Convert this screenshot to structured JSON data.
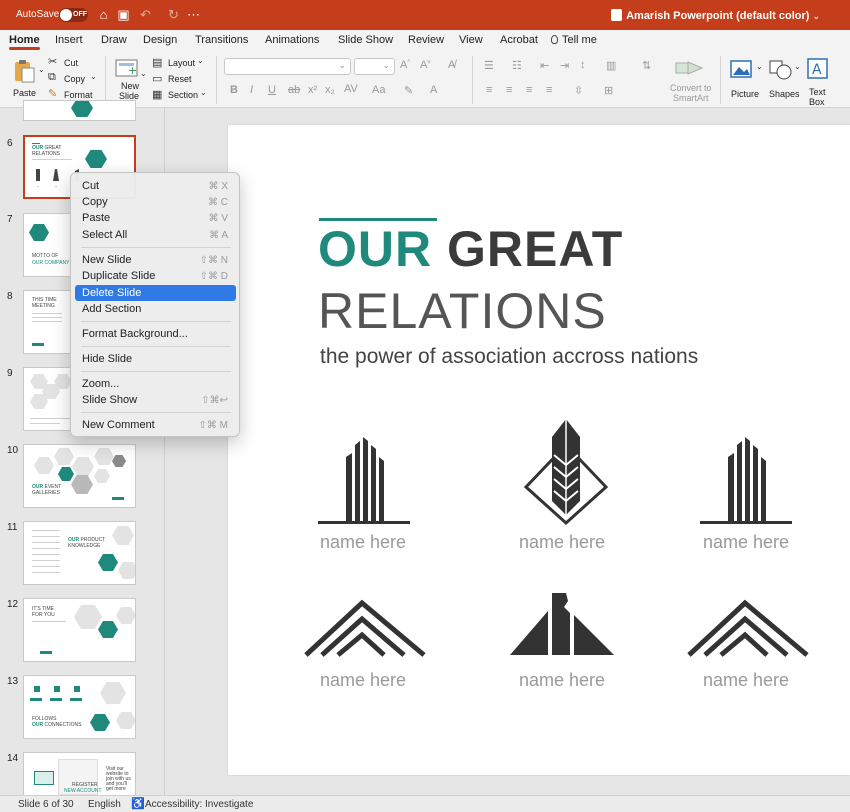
{
  "titlebar": {
    "autosave_label": "AutoSave",
    "autosave_state": "OFF",
    "document_title": "Amarish Powerpoint (default color)"
  },
  "tabs": [
    "Home",
    "Insert",
    "Draw",
    "Design",
    "Transitions",
    "Animations",
    "Slide Show",
    "Review",
    "View",
    "Acrobat",
    "Tell me"
  ],
  "active_tab": "Home",
  "ribbon": {
    "paste": "Paste",
    "cut": "Cut",
    "copy": "Copy",
    "format": "Format",
    "new_slide_line1": "New",
    "new_slide_line2": "Slide",
    "layout": "Layout",
    "reset": "Reset",
    "section": "Section",
    "convert_line1": "Convert to",
    "convert_line2": "SmartArt",
    "picture": "Picture",
    "shapes": "Shapes",
    "textbox_line1": "Text",
    "textbox_line2": "Box"
  },
  "thumbnails": {
    "numbers": [
      "6",
      "7",
      "8",
      "9",
      "10",
      "11",
      "12",
      "13",
      "14"
    ],
    "t6_our": "OUR",
    "t6_great": " GREAT",
    "t6_relations": "RELATIONS",
    "t7_motto": "MOTTO OF",
    "t7_company": "OUR COMPANY",
    "t8_time": "THIS TIME",
    "t8_meeting": "MEETING",
    "t10_our": "OUR",
    "t10_event": " EVENT",
    "t10_galleries": "GALLERIES",
    "t11_our": "OUR",
    "t11_product": " PRODUCT",
    "t11_knowledge": "KNOWLEDGE",
    "t12_its": "IT'S TIME",
    "t12_for": "FOR YOU",
    "t13_follows": "FOLLOWS",
    "t13_our": "OUR",
    "t13_connections": " CONNECTIONS",
    "t14_visit": "Visit our website to join with us and you'll get more",
    "t14_register": "REGISTER",
    "t14_account": "NEW ACCOUNT"
  },
  "context_menu": [
    {
      "label": "Cut",
      "shortcut": "⌘ X"
    },
    {
      "label": "Copy",
      "shortcut": "⌘ C"
    },
    {
      "label": "Paste",
      "shortcut": "⌘ V"
    },
    {
      "label": "Select All",
      "shortcut": "⌘ A"
    },
    {
      "label": "New Slide",
      "shortcut": "⇧⌘ N"
    },
    {
      "label": "Duplicate Slide",
      "shortcut": "⇧⌘ D"
    },
    {
      "label": "Delete Slide",
      "shortcut": ""
    },
    {
      "label": "Add Section",
      "shortcut": ""
    },
    {
      "label": "Format Background...",
      "shortcut": ""
    },
    {
      "label": "Hide Slide",
      "shortcut": ""
    },
    {
      "label": "Zoom...",
      "shortcut": ""
    },
    {
      "label": "Slide Show",
      "shortcut": "⇧⌘↩"
    },
    {
      "label": "New Comment",
      "shortcut": "⇧⌘ M"
    }
  ],
  "highlighted_menu_item": "Delete Slide",
  "slide": {
    "title_highlight": "OUR",
    "title_rest": " GREAT",
    "title_line2": "RELATIONS",
    "subtitle": "the power of association accross nations",
    "icon_labels": [
      "name here",
      "name here",
      "name here",
      "name here",
      "name here",
      "name here"
    ]
  },
  "status": {
    "slide_info": "Slide 6 of 30",
    "language": "English",
    "accessibility": "Accessibility: Investigate"
  },
  "colors": {
    "accent": "#c43e1c",
    "teal": "#1f8a7c",
    "menu_highlight": "#2f7ae5"
  }
}
